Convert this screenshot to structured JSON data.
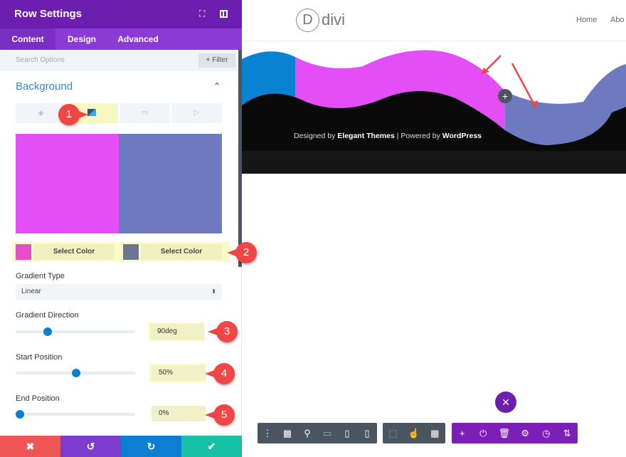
{
  "panel": {
    "title": "Row Settings",
    "tabs": [
      "Content",
      "Design",
      "Advanced"
    ],
    "search_placeholder": "Search Options",
    "filter_label": "+ Filter",
    "section": "Background",
    "bg_tabs": [
      "paint-bucket-icon",
      "gradient-icon",
      "image-icon",
      "video-icon"
    ],
    "gradient_colors": {
      "start": "#e44ef7",
      "end": "#6d7ac0"
    },
    "color_swatches": [
      "#e64dc9",
      "#6b7693"
    ],
    "select_color_label": "Select Color",
    "gradient_type": {
      "label": "Gradient Type",
      "value": "Linear"
    },
    "gradient_direction": {
      "label": "Gradient Direction",
      "value": "90deg",
      "slider": 0.25
    },
    "start_position": {
      "label": "Start Position",
      "value": "50%",
      "slider": 0.5
    },
    "end_position": {
      "label": "End Position",
      "value": "0%",
      "slider": 0
    },
    "footer": [
      "close-icon",
      "undo-icon",
      "redo-icon",
      "check-icon"
    ],
    "callouts": [
      "1",
      "2",
      "3",
      "4",
      "5"
    ]
  },
  "site": {
    "logo_letter": "D",
    "logo_text": "divi",
    "nav": [
      "Home",
      "Abo"
    ],
    "footer_text": {
      "a": "Designed by ",
      "b": "Elegant Themes",
      "c": " | Powered by ",
      "d": "WordPress"
    },
    "colors": {
      "blue": "#0a82d2",
      "magenta": "#e44ef7",
      "periwinkle": "#6d7ac0"
    }
  },
  "toolbar": {
    "left": [
      "more-icon",
      "wireframe-icon",
      "zoom-icon",
      "desktop-icon",
      "tablet-icon",
      "phone-icon"
    ],
    "mid": [
      "select-icon",
      "click-icon",
      "grid-icon"
    ],
    "right": [
      "add-icon",
      "portability-icon",
      "trash-icon",
      "settings-icon",
      "history-icon",
      "sort-icon"
    ]
  }
}
